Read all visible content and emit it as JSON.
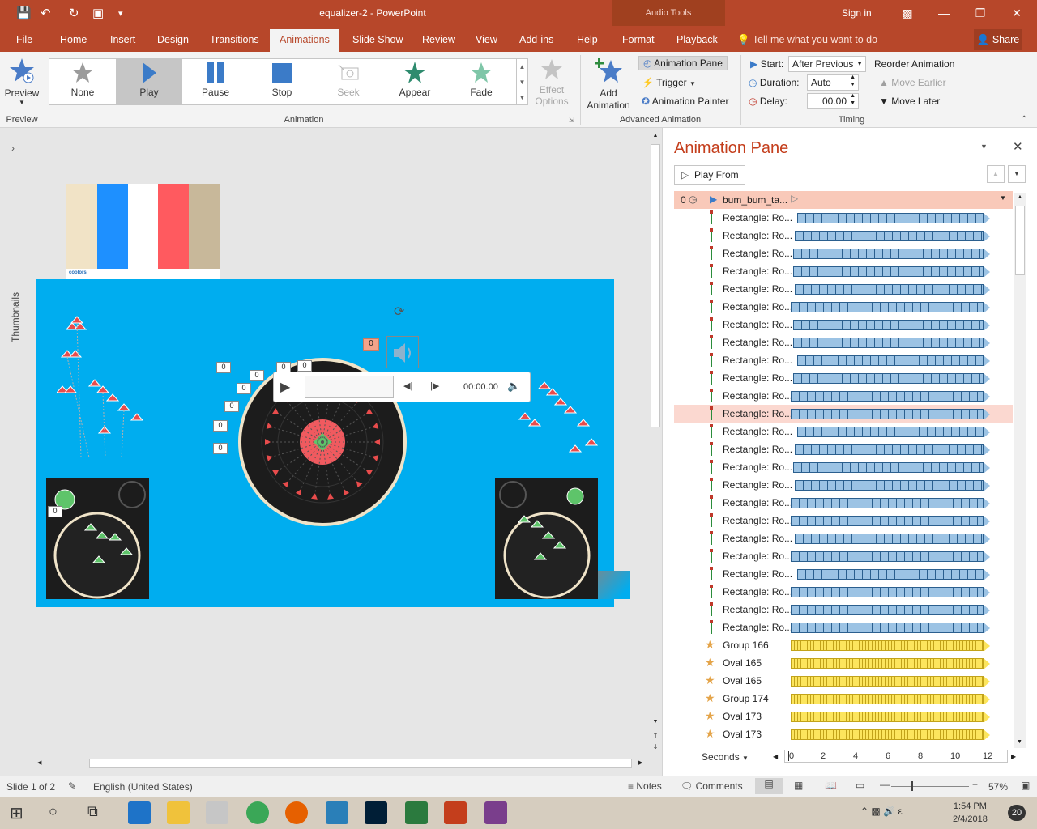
{
  "window": {
    "title": "equalizer-2  -  PowerPoint",
    "context_tab": "Audio Tools",
    "sign_in": "Sign in"
  },
  "menu": {
    "tabs": [
      "File",
      "Home",
      "Insert",
      "Design",
      "Transitions",
      "Animations",
      "Slide Show",
      "Review",
      "View",
      "Add-ins",
      "Help",
      "Format",
      "Playback"
    ],
    "active": "Animations",
    "tell_me": "Tell me what you want to do",
    "share": "Share"
  },
  "ribbon": {
    "preview": {
      "label": "Preview",
      "group": "Preview"
    },
    "animation_gallery": {
      "items": [
        {
          "label": "None",
          "icon": "star-outline-icon"
        },
        {
          "label": "Play",
          "icon": "play-icon"
        },
        {
          "label": "Pause",
          "icon": "pause-icon"
        },
        {
          "label": "Stop",
          "icon": "stop-icon"
        },
        {
          "label": "Seek",
          "icon": "seek-icon"
        },
        {
          "label": "Appear",
          "icon": "appear-icon"
        },
        {
          "label": "Fade",
          "icon": "fade-icon"
        }
      ],
      "selected": "Play",
      "effect_options": "Effect Options",
      "group": "Animation"
    },
    "advanced": {
      "add_animation": "Add Animation",
      "animation_pane": "Animation Pane",
      "trigger": "Trigger",
      "animation_painter": "Animation Painter",
      "group": "Advanced Animation"
    },
    "timing": {
      "start_label": "Start:",
      "start_value": "After Previous",
      "duration_label": "Duration:",
      "duration_value": "Auto",
      "delay_label": "Delay:",
      "delay_value": "00.00",
      "reorder": "Reorder Animation",
      "move_earlier": "Move Earlier",
      "move_later": "Move Later",
      "group": "Timing"
    }
  },
  "sidebar": {
    "thumbnails_label": "Thumbnails"
  },
  "slide": {
    "palette_brand": "coolors",
    "palette_colors": [
      "#f1e3c6",
      "#1e90ff",
      "#ffffff",
      "#ff5a5f",
      "#c8b89a"
    ],
    "slide_bg": "#00adef",
    "media_time": "00:00.00",
    "trigger_tag": "0",
    "count_tags": [
      "0",
      "0",
      "0",
      "0",
      "0",
      "0",
      "0",
      "0",
      "0"
    ]
  },
  "pane": {
    "title": "Animation Pane",
    "play_from": "Play From",
    "header_row": {
      "index": "0",
      "label": "bum_bum_ta..."
    },
    "rows": [
      {
        "label": "Rectangle: Ro...",
        "kind": "blue",
        "start": 0.03
      },
      {
        "label": "Rectangle: Ro...",
        "kind": "blue",
        "start": 0.02
      },
      {
        "label": "Rectangle: Ro...",
        "kind": "blue",
        "start": 0.01
      },
      {
        "label": "Rectangle: Ro...",
        "kind": "blue",
        "start": 0.01
      },
      {
        "label": "Rectangle: Ro...",
        "kind": "blue",
        "start": 0.02
      },
      {
        "label": "Rectangle: Ro...",
        "kind": "blue",
        "start": 0.0
      },
      {
        "label": "Rectangle: Ro...",
        "kind": "blue",
        "start": 0.01
      },
      {
        "label": "Rectangle: Ro...",
        "kind": "blue",
        "start": 0.01
      },
      {
        "label": "Rectangle: Ro...",
        "kind": "blue",
        "start": 0.03
      },
      {
        "label": "Rectangle: Ro...",
        "kind": "blue",
        "start": 0.01
      },
      {
        "label": "Rectangle: Ro...",
        "kind": "blue",
        "start": 0.0
      },
      {
        "label": "Rectangle: Ro...",
        "kind": "blue",
        "start": 0.0,
        "highlight": true
      },
      {
        "label": "Rectangle: Ro...",
        "kind": "blue",
        "start": 0.03
      },
      {
        "label": "Rectangle: Ro...",
        "kind": "blue",
        "start": 0.02
      },
      {
        "label": "Rectangle: Ro...",
        "kind": "blue",
        "start": 0.01
      },
      {
        "label": "Rectangle: Ro...",
        "kind": "blue",
        "start": 0.02
      },
      {
        "label": "Rectangle: Ro...",
        "kind": "blue",
        "start": 0.0
      },
      {
        "label": "Rectangle: Ro...",
        "kind": "blue",
        "start": 0.0
      },
      {
        "label": "Rectangle: Ro...",
        "kind": "blue",
        "start": 0.02
      },
      {
        "label": "Rectangle: Ro...",
        "kind": "blue",
        "start": 0.0
      },
      {
        "label": "Rectangle: Ro...",
        "kind": "blue",
        "start": 0.03
      },
      {
        "label": "Rectangle: Ro...",
        "kind": "blue",
        "start": 0.0
      },
      {
        "label": "Rectangle: Ro...",
        "kind": "blue",
        "start": 0.0
      },
      {
        "label": "Rectangle: Ro...",
        "kind": "blue",
        "start": 0.0
      },
      {
        "label": "Group 166",
        "kind": "yellow",
        "start": 0.0
      },
      {
        "label": "Oval 165",
        "kind": "yellow",
        "start": 0.0
      },
      {
        "label": "Oval 165",
        "kind": "yellow",
        "start": 0.0
      },
      {
        "label": "Group 174",
        "kind": "yellow",
        "start": 0.0
      },
      {
        "label": "Oval 173",
        "kind": "yellow",
        "start": 0.0
      },
      {
        "label": "Oval 173",
        "kind": "yellow",
        "start": 0.0
      }
    ],
    "seconds_label": "Seconds",
    "timeline_ticks": [
      "0",
      "2",
      "4",
      "6",
      "8",
      "10",
      "12"
    ]
  },
  "status": {
    "slide": "Slide 1 of 2",
    "language": "English (United States)",
    "notes": "Notes",
    "comments": "Comments",
    "zoom": "57%"
  },
  "taskbar": {
    "time": "1:54 PM",
    "date": "2/4/2018",
    "notifications": "20"
  }
}
